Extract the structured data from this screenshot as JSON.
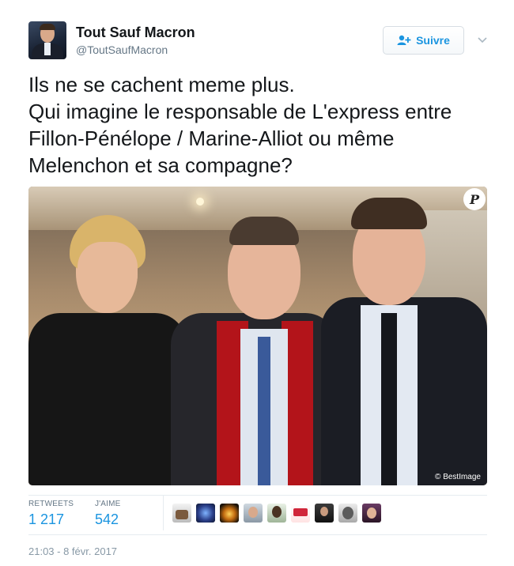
{
  "author": {
    "display_name": "Tout Sauf Macron",
    "screen_name": "@ToutSaufMacron",
    "avatar_icon": "profile-photo"
  },
  "follow_button": {
    "label": "Suivre",
    "icon": "add-user-icon"
  },
  "tweet": {
    "text": "Ils ne se cachent meme plus.\nQui imagine le responsable de L'express entre Fillon-Pénélope / Marine-Alliot ou même Melenchon et sa compagne?"
  },
  "photo": {
    "watermark_logo": "P",
    "credit": "© BestImage"
  },
  "stats": {
    "retweets_label": "RETWEETS",
    "retweets_value": "1 217",
    "likes_label": "J'AIME",
    "likes_value": "542"
  },
  "likers_count_shown": 9,
  "timestamp": "21:03 - 8 févr. 2017",
  "colors": {
    "link_blue": "#1b95e0",
    "text_dark": "#14171a",
    "text_muted": "#657786"
  }
}
